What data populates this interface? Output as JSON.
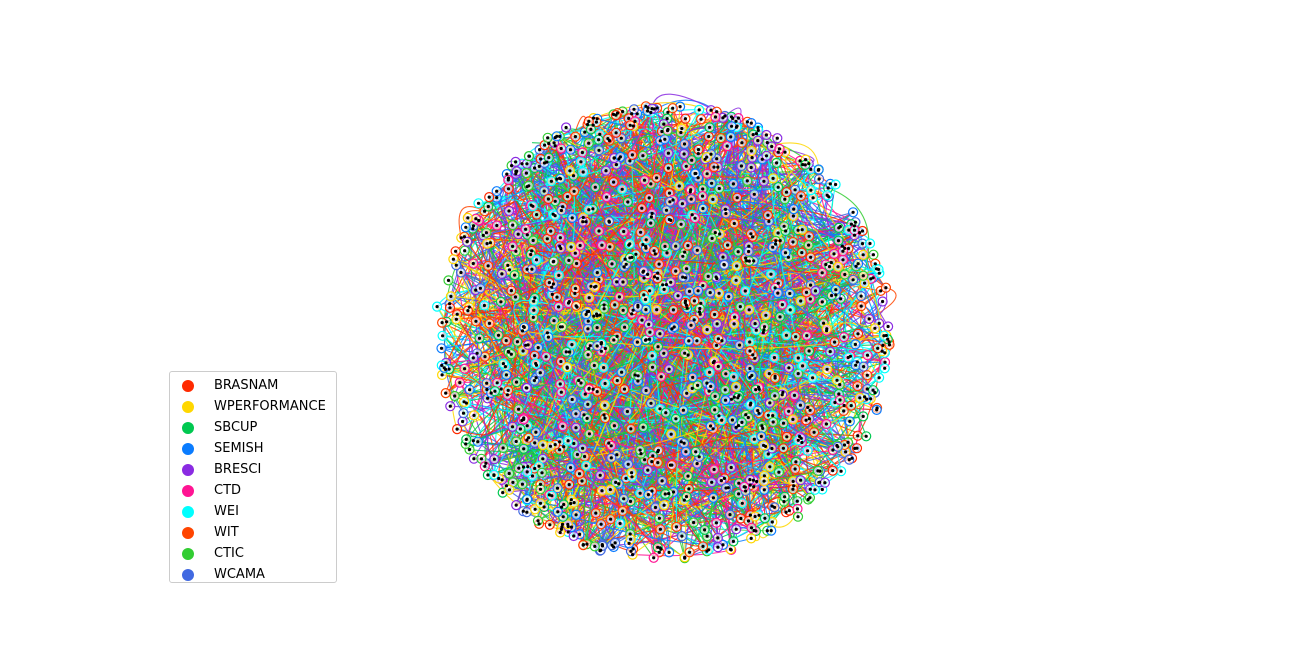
{
  "graph": {
    "node_color": "#000000",
    "ring_colors": [
      "#ff2a00",
      "#ffd700",
      "#00c850",
      "#0a7cff",
      "#8a2be2",
      "#ff1493",
      "#00ffff",
      "#ff4500",
      "#32cd32",
      "#4169e1"
    ]
  },
  "legend": {
    "items": [
      {
        "label": "BRASNAM",
        "color": "#ff2a00"
      },
      {
        "label": "WPERFORMANCE",
        "color": "#ffd700"
      },
      {
        "label": "SBCUP",
        "color": "#00c850"
      },
      {
        "label": "SEMISH",
        "color": "#0a7cff"
      },
      {
        "label": "BRESCI",
        "color": "#8a2be2"
      },
      {
        "label": "CTD",
        "color": "#ff1493"
      },
      {
        "label": "WEI",
        "color": "#00ffff"
      },
      {
        "label": "WIT",
        "color": "#ff4500"
      },
      {
        "label": "CTIC",
        "color": "#32cd32"
      },
      {
        "label": "WCAMA",
        "color": "#4169e1"
      }
    ]
  }
}
